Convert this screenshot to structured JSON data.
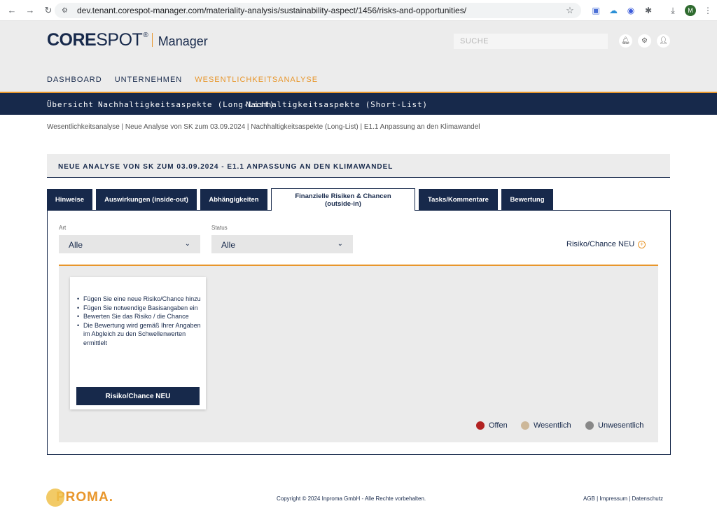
{
  "browser": {
    "url": "dev.tenant.corespot-manager.com/materiality-analysis/sustainability-aspect/1456/risks-and-opportunities/",
    "profile_initial": "M"
  },
  "header": {
    "logo_core": "CORE",
    "logo_spot": "SPOT",
    "logo_reg": "®",
    "logo_manager": "Manager",
    "search_placeholder": "SUCHE"
  },
  "mainnav": [
    "DASHBOARD",
    "UNTERNEHMEN",
    "WESENTLICHKEITSANALYSE"
  ],
  "subnav": [
    "Übersicht",
    "Nachhaltigkeitsaspekte (Long-List)",
    "Nachhaltigkeitsaspekte (Short-List)"
  ],
  "breadcrumb": "Wesentlichkeitsanalyse  |  Neue Analyse von SK zum 03.09.2024  |  Nachhaltigkeitsaspekte (Long-List)  |  E1.1 Anpassung an den Klimawandel",
  "panel_title": "NEUE ANALYSE VON SK ZUM 03.09.2024 - E1.1 ANPASSUNG AN DEN KLIMAWANDEL",
  "tabs": [
    {
      "label": "Hinweise"
    },
    {
      "label": "Auswirkungen (inside-out)"
    },
    {
      "label": "Abhängigkeiten"
    },
    {
      "label": "Finanzielle Risiken & Chancen (outside-in)"
    },
    {
      "label": "Tasks/Kommentare"
    },
    {
      "label": "Bewertung"
    }
  ],
  "filters": {
    "art_label": "Art",
    "art_value": "Alle",
    "status_label": "Status",
    "status_value": "Alle"
  },
  "add_link": "Risiko/Chance NEU",
  "card": {
    "items": [
      "Fügen Sie eine neue Risiko/Chance hinzu",
      "Fügen Sie notwendige Basisangaben ein",
      "Bewerten Sie das Risiko / die Chance",
      "Die Bewertung wird gemäß Ihrer Angaben im Abgleich zu den Schwellenwerten ermittlelt"
    ],
    "button": "Risiko/Chance NEU"
  },
  "legend": [
    {
      "label": "Offen",
      "color": "#b22222"
    },
    {
      "label": "Wesentlich",
      "color": "#cdb89a"
    },
    {
      "label": "Unwesentlich",
      "color": "#888888"
    }
  ],
  "footer": {
    "logo_text": "PROMA.",
    "copyright": "Copyright © 2024 Inproma GmbH - Alle Rechte vorbehalten.",
    "links": "AGB | Impressum | Datenschutz"
  }
}
